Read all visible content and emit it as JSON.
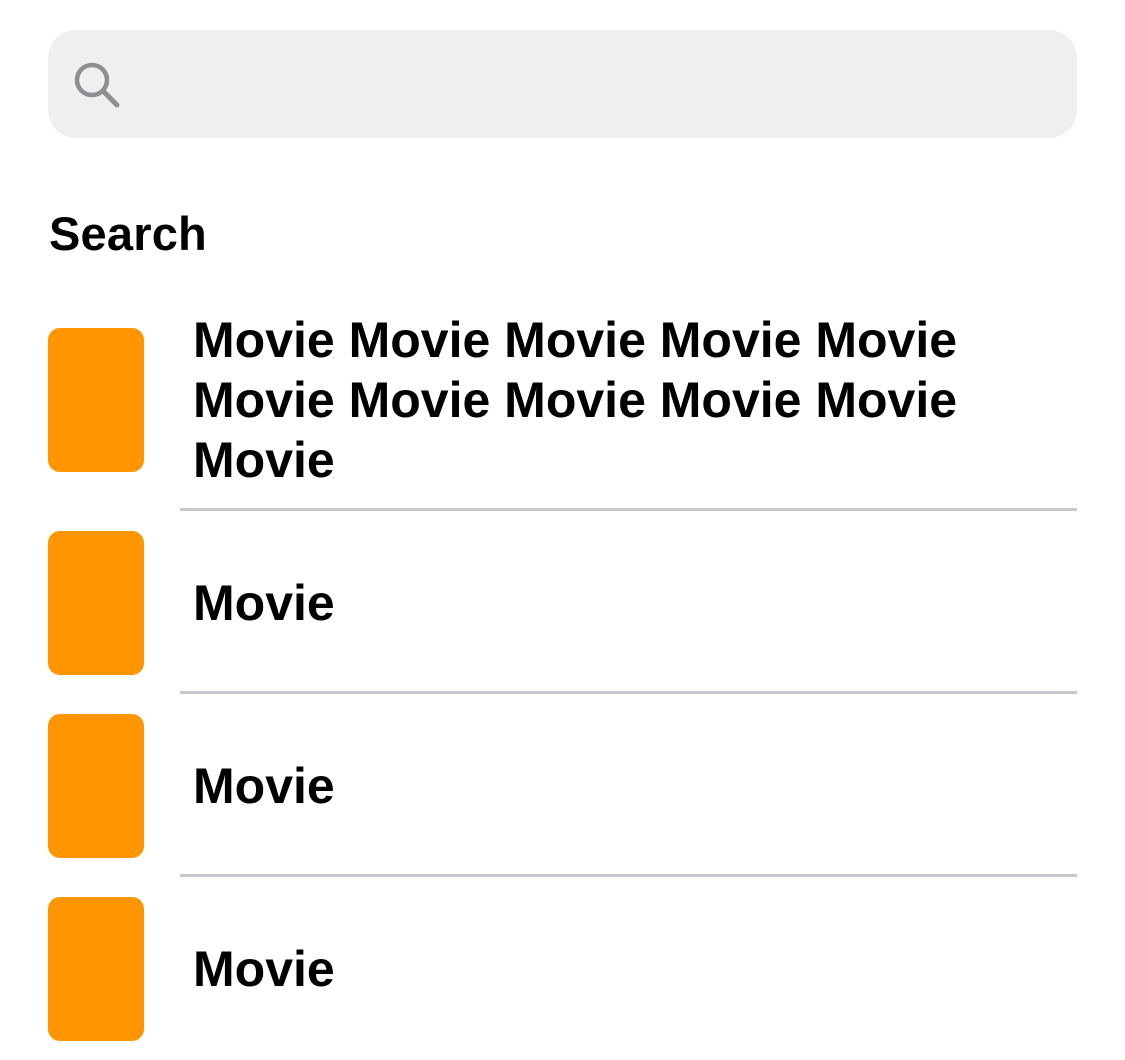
{
  "search": {
    "placeholder": "",
    "value": ""
  },
  "section": {
    "title": "Search"
  },
  "results": [
    {
      "title": "Movie Movie Movie Movie Movie Movie Movie Movie Movie Movie Movie",
      "thumb_color": "#FF9500"
    },
    {
      "title": "Movie",
      "thumb_color": "#FF9500"
    },
    {
      "title": "Movie",
      "thumb_color": "#FF9500"
    },
    {
      "title": "Movie",
      "thumb_color": "#FF9500"
    }
  ],
  "icons": {
    "search": "search-icon"
  },
  "colors": {
    "accent": "#FF9500",
    "search_bg": "#EFEFEF",
    "separator": "#C8C8CC",
    "icon_gray": "#8E8E93"
  }
}
